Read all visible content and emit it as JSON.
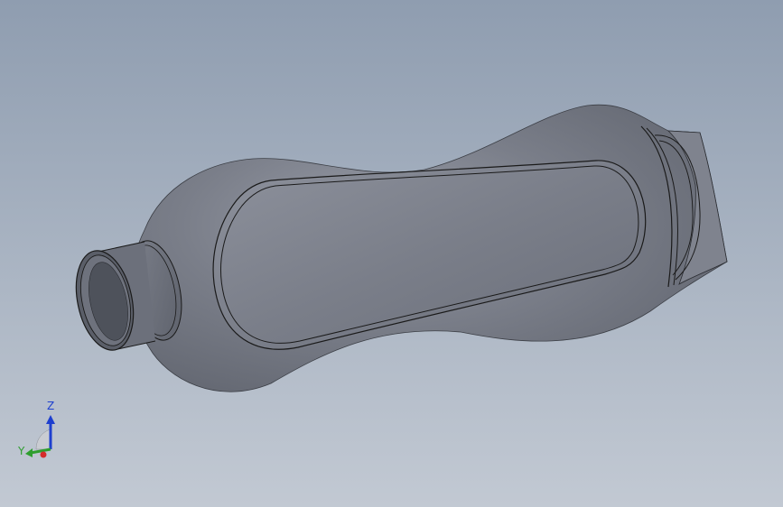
{
  "viewport": {
    "background_top": "#8f9db0",
    "background_bottom": "#c2c9d3"
  },
  "model": {
    "part": "bottle",
    "body_color": "#6f737e",
    "highlight_color": "#9a9ea8",
    "edge_color": "#1a1a1a"
  },
  "triad": {
    "z_label": "Z",
    "y_label": "Y",
    "z_color": "#1e3fcf",
    "y_color": "#2e9e2e",
    "x_color": "#d42b2b"
  }
}
